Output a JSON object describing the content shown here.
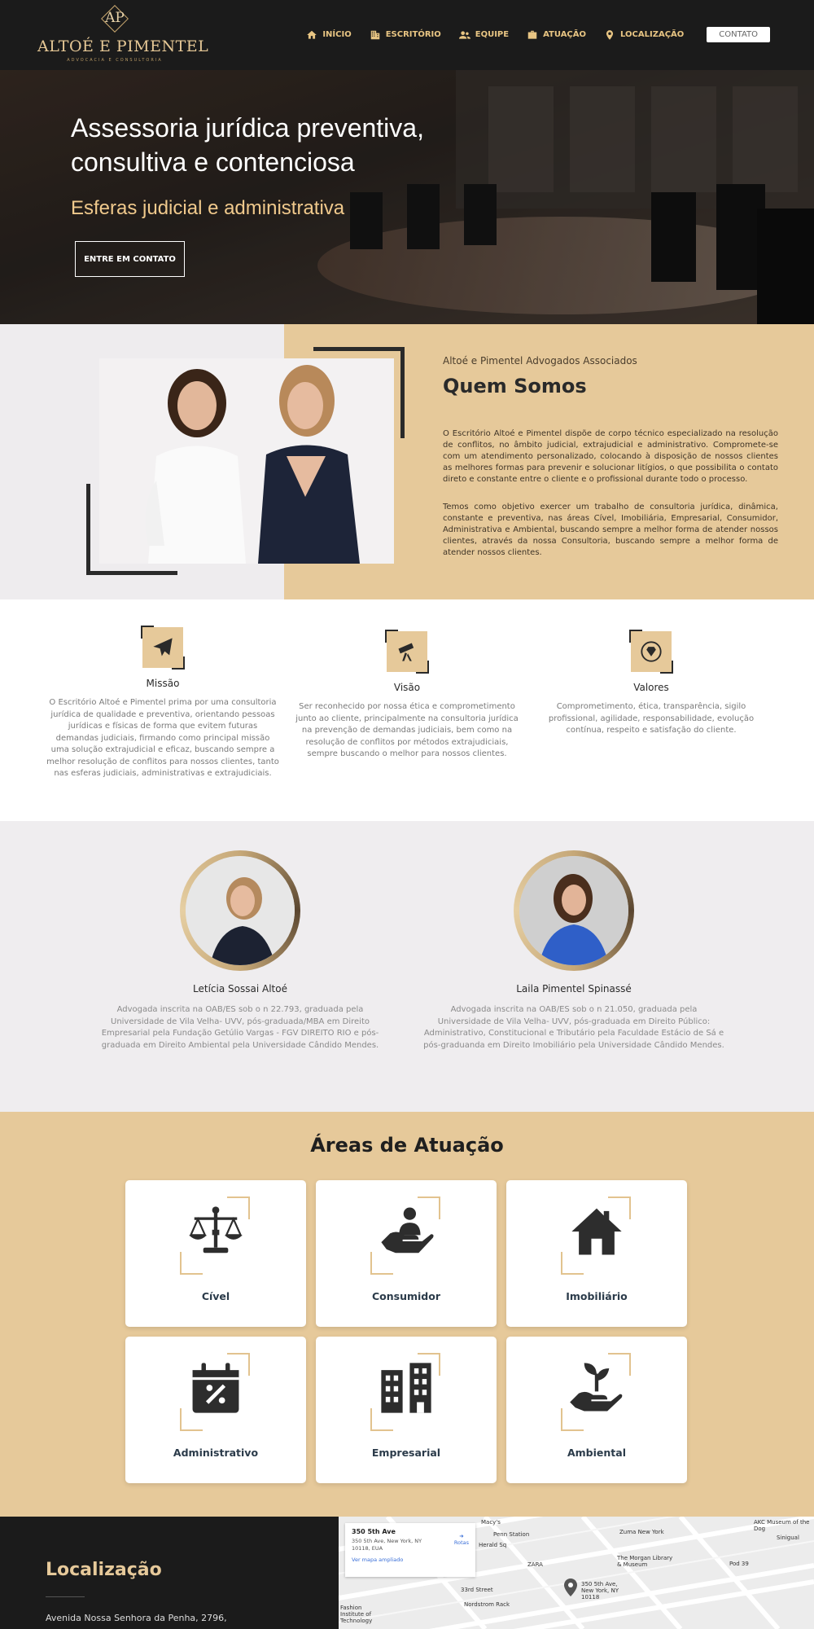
{
  "brand": {
    "monogram": "AP",
    "name": "ALTOÉ E PIMENTEL",
    "tagline": "ADVOCACIA E CONSULTORIA"
  },
  "nav": {
    "items": [
      {
        "label": "INÍCIO",
        "icon": "home-icon"
      },
      {
        "label": "ESCRITÓRIO",
        "icon": "building-icon"
      },
      {
        "label": "EQUIPE",
        "icon": "people-icon"
      },
      {
        "label": "ATUAÇÃO",
        "icon": "briefcase-icon"
      },
      {
        "label": "LOCALIZAÇÃO",
        "icon": "location-pin-icon"
      }
    ],
    "contact_label": "CONTATO"
  },
  "hero": {
    "title_line1": "Assessoria jurídica preventiva,",
    "title_line2": "consultiva e contenciosa",
    "subtitle": "Esferas judicial e administrativa",
    "cta_label": "ENTRE EM CONTATO"
  },
  "about": {
    "kicker": "Altoé e Pimentel Advogados Associados",
    "title": "Quem Somos",
    "paragraph1": "O Escritório Altoé e Pimentel dispõe de corpo técnico especializado na resolução de conflitos, no âmbito judicial, extrajudicial e administrativo. Compromete-se com um atendimento personalizado, colocando à disposição de nossos clientes as melhores formas para prevenir e solucionar litígios, o que possibilita o contato direto e constante entre o cliente e o profissional durante todo o processo.",
    "paragraph2": "Temos como objetivo exercer um trabalho de consultoria jurídica, dinâmica, constante e preventiva, nas áreas Cível, Imobiliária, Empresarial, Consumidor, Administrativa e Ambiental, buscando sempre a melhor forma de atender nossos clientes, através da nossa Consultoria, buscando sempre a melhor forma de atender nossos clientes."
  },
  "mvv": [
    {
      "title": "Missão",
      "icon": "paper-plane-icon",
      "text": "O Escritório Altoé e Pimentel prima por uma consultoria jurídica de qualidade e preventiva, orientando pessoas jurídicas e físicas de forma que evitem futuras demandas judiciais, firmando como principal missão uma solução extrajudicial e eficaz, buscando sempre a melhor resolução de conflitos para nossos clientes, tanto nas esferas judiciais, administrativas e extrajudiciais."
    },
    {
      "title": "Visão",
      "icon": "telescope-icon",
      "text": "Ser reconhecido por nossa ética e comprometimento junto ao cliente, principalmente na consultoria jurídica na prevenção de demandas judiciais, bem como na resolução de conflitos por métodos extrajudiciais, sempre buscando o melhor para nossos clientes."
    },
    {
      "title": "Valores",
      "icon": "diamond-icon",
      "text": "Comprometimento, ética, transparência, sigilo profissional, agilidade, responsabilidade, evolução contínua, respeito e satisfação do cliente."
    }
  ],
  "team": [
    {
      "name": "Letícia Sossai Altoé",
      "bio": "Advogada inscrita na OAB/ES sob o n 22.793, graduada pela Universidade de Vila Velha- UVV, pós-graduada/MBA em Direito Empresarial pela Fundação Getúlio Vargas - FGV DIREITO RIO e pós-graduada em Direito Ambiental pela Universidade Cândido Mendes."
    },
    {
      "name": "Laila Pimentel Spinassé",
      "bio": "Advogada inscrita na OAB/ES sob o n 21.050, graduada pela Universidade de Vila Velha- UVV, pós-graduada em Direito Público: Administrativo, Constitucional e Tributário pela Faculdade Estácio de Sá e pós-graduanda em Direito Imobiliário pela Universidade Cândido Mendes."
    }
  ],
  "areas": {
    "title": "Áreas de Atuação",
    "items": [
      {
        "label": "Cível",
        "icon": "scales-icon"
      },
      {
        "label": "Consumidor",
        "icon": "hand-person-icon"
      },
      {
        "label": "Imobiliário",
        "icon": "house-icon"
      },
      {
        "label": "Administrativo",
        "icon": "calendar-percent-icon"
      },
      {
        "label": "Empresarial",
        "icon": "buildings-icon"
      },
      {
        "label": "Ambiental",
        "icon": "hand-plant-icon"
      }
    ]
  },
  "location": {
    "title": "Localização",
    "address": "Avenida Nossa Senhora da Penha, 2796,"
  },
  "map": {
    "place_title": "350 5th Ave",
    "place_address": "350 5th Ave, New York, NY 10118, EUA",
    "larger_map": "Ver mapa ampliado",
    "directions": "Rotas",
    "pin_label": "350 5th Ave, New York, NY 10118",
    "labels": [
      "Macy's",
      "Penn Station",
      "Herald Sq",
      "ZARA",
      "Zuma New York",
      "The Morgan Library & Museum",
      "Pod 39",
      "AKC Museum of the Dog",
      "Sinigual",
      "33rd Street",
      "Nordstrom Rack",
      "Fashion Institute of Technology"
    ]
  }
}
